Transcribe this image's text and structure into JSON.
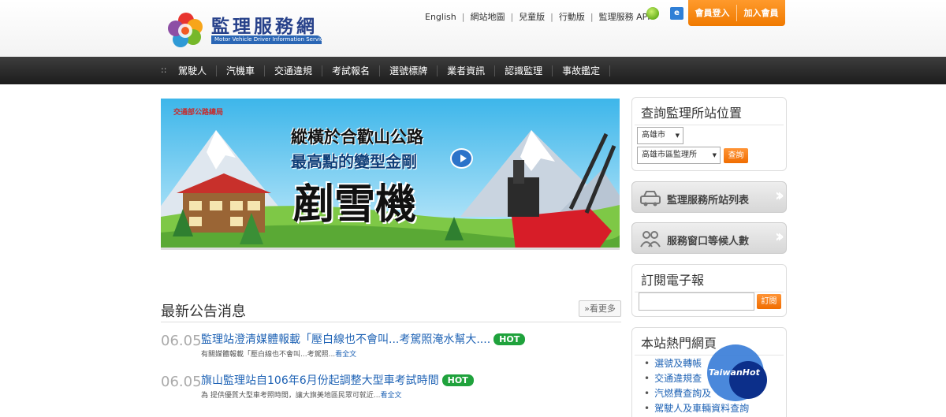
{
  "header": {
    "logo_title": "監理服務網",
    "logo_subtitle": "Motor Vehicle Driver Information Service",
    "top_links": [
      "English",
      "網站地圖",
      "兒童版",
      "行動版",
      "監理服務 APP"
    ],
    "login_label": "會員登入",
    "join_label": "加入會員"
  },
  "nav": {
    "handle": "::",
    "items": [
      "駕駛人",
      "汽機車",
      "交通違規",
      "考試報名",
      "選號標牌",
      "業者資訊",
      "認識監理",
      "事故鑑定"
    ]
  },
  "banner": {
    "agency": "交通部公路總局",
    "line1": "縱橫於合歡山公路",
    "line2": "最高點的變型金剛",
    "line3": "剷雪機"
  },
  "news": {
    "title": "最新公告消息",
    "more": "»看更多",
    "items": [
      {
        "date": "06.05",
        "headline": "監理站澄清媒體報載「壓白線也不會叫...考駕照淹水幫大....",
        "badge": "HOT",
        "summary": "有關媒體報載「壓白線也不會叫...考駕照...",
        "full": "看全文"
      },
      {
        "date": "06.05",
        "headline": "旗山監理站自106年6月份起調整大型車考試時間",
        "badge": "HOT",
        "summary": "為 提供優質大型車考照時間，讓大旗美地區民眾可就近...",
        "full": "看全文"
      }
    ]
  },
  "sidebar": {
    "locate_title": "查詢監理所站位置",
    "city_value": "高雄市",
    "office_value": "高雄市區監理所",
    "query_label": "查詢",
    "station_list_label": "監理服務所站列表",
    "queue_label": "服務窗口等候人數",
    "newsletter_title": "訂閱電子報",
    "subscribe_label": "訂閱",
    "hot_title": "本站熱門網頁",
    "hot_links": [
      "選號及轉帳",
      "交通違規查",
      "汽燃費查詢及",
      "駕駛人及車輛資料查詢"
    ]
  },
  "watermark": "TaiwanHot"
}
